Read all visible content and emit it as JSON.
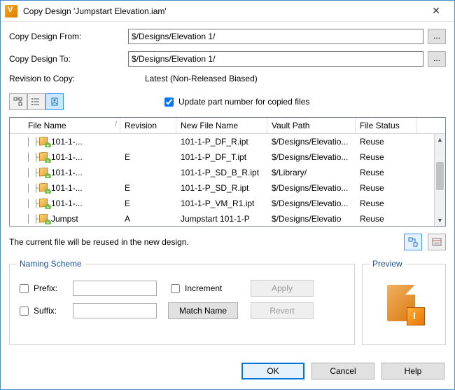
{
  "window": {
    "title": "Copy Design 'Jumpstart Elevation.iam'"
  },
  "fields": {
    "from_label": "Copy Design From:",
    "from_value": "$/Designs/Elevation 1/",
    "to_label": "Copy Design To:",
    "to_value": "$/Designs/Elevation 1/",
    "rev_label": "Revision to Copy:",
    "rev_value": "Latest (Non-Released Biased)",
    "browse": "..."
  },
  "update_checkbox": "Update part number for copied files",
  "columns": {
    "file": "File Name",
    "rev": "Revision",
    "new": "New File Name",
    "path": "Vault Path",
    "status": "File Status"
  },
  "rows": [
    {
      "file": "101-1-...",
      "rev": "",
      "new": "101-1-P_DF_R.ipt",
      "path": "$/Designs/Elevatio...",
      "status": "Reuse"
    },
    {
      "file": "101-1-...",
      "rev": "E",
      "new": "101-1-P_DF_T.ipt",
      "path": "$/Designs/Elevatio...",
      "status": "Reuse"
    },
    {
      "file": "101-1-...",
      "rev": "",
      "new": "101-1-P_SD_B_R.ipt",
      "path": "$/Library/",
      "status": "Reuse"
    },
    {
      "file": "101-1-...",
      "rev": "E",
      "new": "101-1-P_SD_R.ipt",
      "path": "$/Designs/Elevatio...",
      "status": "Reuse"
    },
    {
      "file": "101-1-...",
      "rev": "E",
      "new": "101-1-P_VM_R1.ipt",
      "path": "$/Designs/Elevatio...",
      "status": "Reuse"
    },
    {
      "file": "Jumpst",
      "rev": "A",
      "new": "Jumpstart 101-1-P",
      "path": "$/Designs/Elevatio",
      "status": "Reuse"
    }
  ],
  "status_msg": "The current file will be reused in the new design.",
  "naming": {
    "legend": "Naming Scheme",
    "prefix": "Prefix:",
    "suffix": "Suffix:",
    "increment": "Increment",
    "match": "Match Name",
    "apply": "Apply",
    "revert": "Revert"
  },
  "preview": {
    "legend": "Preview"
  },
  "footer": {
    "ok": "OK",
    "cancel": "Cancel",
    "help": "Help"
  }
}
